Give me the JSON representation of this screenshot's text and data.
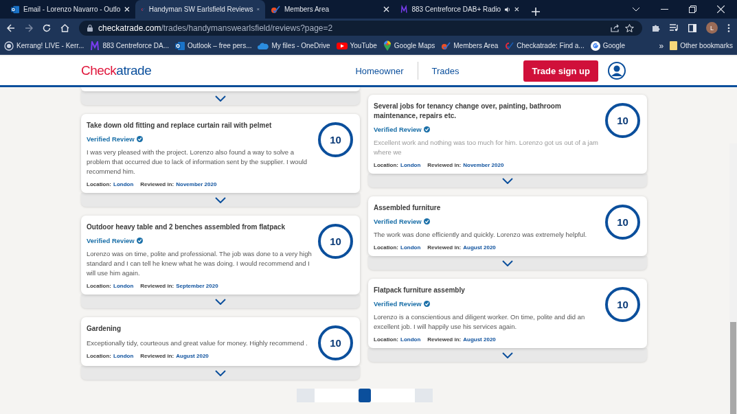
{
  "browser": {
    "tabs": [
      {
        "title": "Email - Lorenzo Navarro - Outlo",
        "kind": "outlook",
        "selected": false,
        "audio": false
      },
      {
        "title": "Handyman SW Earlsfield Reviews",
        "kind": "checkatrade",
        "selected": true,
        "audio": false
      },
      {
        "title": "Members Area",
        "kind": "members",
        "selected": false,
        "audio": false
      },
      {
        "title": "883 Centreforce DAB+ Radio",
        "kind": "centreforce",
        "selected": false,
        "audio": true
      }
    ],
    "address": {
      "domain": "checkatrade.com",
      "path": "/trades/handymanswearlsfield/reviews?page=2"
    },
    "avatar": "L",
    "bookmarks": [
      {
        "label": "Kerrang! LIVE - Kerr...",
        "kind": "radio"
      },
      {
        "label": "883 Centreforce DA...",
        "kind": "centreforce"
      },
      {
        "label": "Outlook – free pers...",
        "kind": "outlook"
      },
      {
        "label": "My files - OneDrive",
        "kind": "cloud"
      },
      {
        "label": "YouTube",
        "kind": "youtube"
      },
      {
        "label": "Google Maps",
        "kind": "maps"
      },
      {
        "label": "Members Area",
        "kind": "members"
      },
      {
        "label": "Checkatrade: Find a...",
        "kind": "checkatrade"
      },
      {
        "label": "Google",
        "kind": "google"
      }
    ],
    "more": "»",
    "other_bookmarks": "Other bookmarks"
  },
  "header": {
    "logo": [
      "Chec",
      "k",
      "atrade"
    ],
    "nav": [
      "Homeowner",
      "Trades"
    ],
    "signup": "Trade sign up"
  },
  "columns": [
    [
      {
        "kind": "partial"
      },
      {
        "kind": "review",
        "title": "Take down old fitting and replace curtain rail with pelmet",
        "verified": true,
        "verified_label": "Verified Review",
        "text": "I was very pleased with the project. Lorenzo also found a way to solve a problem that occurred due to lack of information sent by the supplier. I would recommend him.",
        "truncated": false,
        "location_label": "Location:",
        "location": "London",
        "reviewed_label": "Reviewed in:",
        "reviewed": "November 2020",
        "score": "10"
      },
      {
        "kind": "review",
        "title": "Outdoor heavy table and 2 benches assembled from flatpack",
        "verified": true,
        "verified_label": "Verified Review",
        "text": "Lorenzo was on time, polite and professional. The job was done to a very high standard and I can tell he knew what he was doing. I would recommend and I will use him again.",
        "truncated": false,
        "location_label": "Location:",
        "location": "London",
        "reviewed_label": "Reviewed in:",
        "reviewed": "September 2020",
        "score": "10"
      },
      {
        "kind": "review",
        "title": "Gardening",
        "verified": false,
        "text": "Exceptionally tidy, courteous and great value for money. Highly recommend .",
        "truncated": false,
        "location_label": "Location:",
        "location": "London",
        "reviewed_label": "Reviewed in:",
        "reviewed": "August 2020",
        "score": "10"
      }
    ],
    [
      {
        "kind": "review",
        "title": "Several jobs for tenancy change over, painting, bathroom maintenance, repairs etc.",
        "verified": true,
        "verified_label": "Verified Review",
        "text": "Excellent work and nothing was too much for him. Lorenzo got us out of a jam where we",
        "truncated": true,
        "location_label": "Location:",
        "location": "London",
        "reviewed_label": "Reviewed in:",
        "reviewed": "November 2020",
        "score": "10"
      },
      {
        "kind": "review",
        "title": "Assembled furniture",
        "verified": true,
        "verified_label": "Verified Review",
        "text": "The work was done efficiently and quickly. Lorenzo was extremely helpful.",
        "truncated": false,
        "location_label": "Location:",
        "location": "London",
        "reviewed_label": "Reviewed in:",
        "reviewed": "August 2020",
        "score": "10"
      },
      {
        "kind": "review",
        "title": "Flatpack furniture assembly",
        "verified": true,
        "verified_label": "Verified Review",
        "text": "Lorenzo is a conscientious and diligent worker. On time, polite and did an excellent job. I will happily use his services again.",
        "truncated": false,
        "location_label": "Location:",
        "location": "London",
        "reviewed_label": "Reviewed in:",
        "reviewed": "August 2020",
        "score": "10"
      }
    ]
  ],
  "pagination": [
    {
      "kind": "prev",
      "selected": false
    },
    {
      "kind": "page",
      "selected": false
    },
    {
      "kind": "page",
      "selected": true
    },
    {
      "kind": "page",
      "selected": false
    },
    {
      "kind": "next",
      "selected": false
    }
  ]
}
